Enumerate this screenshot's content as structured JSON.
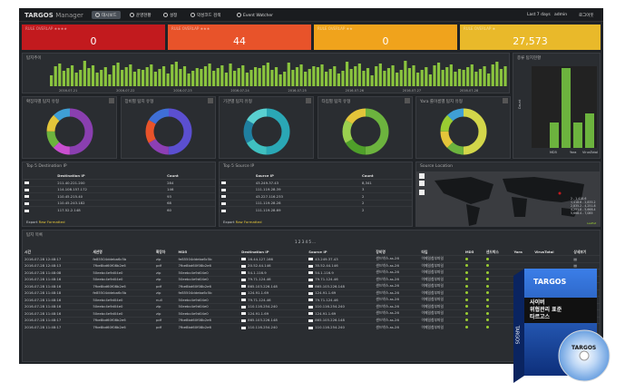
{
  "app": {
    "brand": "TARGOS",
    "brand_sub": "Manager"
  },
  "nav": [
    {
      "label": "대시보드",
      "icon": "dashboard-icon"
    },
    {
      "label": "운영현황",
      "icon": "status-icon"
    },
    {
      "label": "설정",
      "icon": "gear-icon"
    },
    {
      "label": "악성코드 검색",
      "icon": "search-icon"
    },
    {
      "label": "Event Watcher",
      "icon": "event-icon"
    }
  ],
  "top_right": {
    "range": "Last 7 days",
    "user": "admin",
    "logout": "로그아웃"
  },
  "kpis": [
    {
      "label": "RULE OVERLAP ★★★★",
      "value": "0",
      "color": "#c21a1e"
    },
    {
      "label": "RULE OVERLAP ★★★",
      "value": "44",
      "color": "#e8532a"
    },
    {
      "label": "RULE OVERLAP ★★",
      "value": "0",
      "color": "#f0a31c"
    },
    {
      "label": "RULE OVERLAP ★",
      "value": "27,573",
      "color": "#e9b92a"
    }
  ],
  "timeline": {
    "title": "탐지추이",
    "axis": [
      "2016-07-21",
      "2016-07-22",
      "2016-07-23",
      "2016-07-24",
      "2016-07-25",
      "2016-07-26",
      "2016-07-27",
      "2016-07-28"
    ]
  },
  "bar_panel": {
    "title": "종류 탐지현황",
    "ylabel": "Count",
    "xlabels": [
      "MD5",
      "Yara",
      "VirusTotal"
    ]
  },
  "donuts": [
    {
      "title": "확장자별 탐지 유형",
      "colors": [
        "#8a3fb0",
        "#c94fd0",
        "#6cb33e",
        "#e3c53a",
        "#3f9fd6"
      ]
    },
    {
      "title": "장비별 탐지 유형",
      "colors": [
        "#5b4fd0",
        "#8d3fb5",
        "#e8532a",
        "#3f6fd6"
      ]
    },
    {
      "title": "기관별 탐지 유형",
      "colors": [
        "#2aa7b5",
        "#3fc0c0",
        "#1f7fa0",
        "#59d0d0"
      ]
    },
    {
      "title": "타입별 탐지 유형",
      "colors": [
        "#6cb33e",
        "#4f9f2a",
        "#9ad04f",
        "#e3c53a"
      ]
    },
    {
      "title": "Yara 룰이름별 탐지 유형",
      "colors": [
        "#d3d64a",
        "#6cb33e",
        "#e3c53a",
        "#9acd32",
        "#3f9fd6"
      ]
    }
  ],
  "top_dest": {
    "title": "Top 5 Destination IP",
    "headers": [
      "Destination IP",
      "Count"
    ],
    "rows": [
      [
        "211.40.221.200",
        "284"
      ],
      [
        "114.108.157.172",
        "146"
      ],
      [
        "110.45.215.40",
        "93"
      ],
      [
        "110.45.243.182",
        "68"
      ],
      [
        "117.52.2.148",
        "60"
      ]
    ],
    "export": "Export",
    "raw": "Raw",
    "formatted": "Formatted"
  },
  "top_src": {
    "title": "Top 5 Source IP",
    "headers": [
      "Source IP",
      "Count"
    ],
    "rows": [
      [
        "43.249.37.43",
        "8,341"
      ],
      [
        "111.119.28.39",
        "3"
      ],
      [
        "43.227.116.233",
        "2"
      ],
      [
        "111.119.28.28",
        "2"
      ],
      [
        "111.119.28.69",
        "2"
      ]
    ],
    "export": "Export",
    "raw": "Raw",
    "formatted": "Formatted"
  },
  "map": {
    "title": "Source Location",
    "legend": [
      "2 - 1,418.6",
      "1,418.6 - 2,835.2",
      "2,835.2 - 4,251.8",
      "4,251.8 - 5,668.4",
      "5,668.4 - 7,085"
    ],
    "credit": "Leaflet"
  },
  "list": {
    "title": "탐지 목록",
    "pages": [
      "1",
      "2",
      "3",
      "4",
      "5",
      "..."
    ],
    "headers": [
      "시간",
      "세션명",
      "확장자",
      "MD5",
      "Destination IP",
      "Source IP",
      "장비명",
      "타입",
      "MD5",
      "샌드박스",
      "Yara",
      "VirusTotal",
      "상세보기"
    ],
    "rows": [
      [
        "2016-07-28 12:48:17",
        "fe85504ddeba6c5b",
        "zip",
        "fe85504ddeba6c5b",
        "16.44.127.166",
        "43.249.37.43",
        "샌드박스-ss-26",
        "이메일첨부파일"
      ],
      [
        "2016-07-28 12:48:13",
        "7fbe8bd60f08b2e6",
        "pdf",
        "7fbe8bd60f08b2e6",
        "20.52.44.146",
        "35.52.44.146",
        "샌드박스-ss-26",
        "이메일첨부파일"
      ],
      [
        "2016-07-28 11:48:08",
        "50eebc4e9d04e0",
        "zip",
        "50eebc4e9d04e0",
        "54.1.116.9",
        "54.1.116.9",
        "샌드박스-ss-26",
        "이메일첨부파일"
      ],
      [
        "2016-07-28 11:48:16",
        "50eebc4e9d04e0",
        "zip",
        "50eebc4e9d04e0",
        "79.71.124.46",
        "79.71.124.46",
        "샌드박스-ss-26",
        "이메일첨부파일"
      ],
      [
        "2016-07-28 11:48:16",
        "7fbe8bd60f08b2e6",
        "pdf",
        "7fbe8bd60f08b2e6",
        "865.103.226.148",
        "865.103.226.148",
        "샌드박스-ss-26",
        "이메일첨부파일"
      ],
      [
        "2016-07-28 11:48:18",
        "fe85504ddeba6c5b",
        "zip",
        "fe85504ddeba6c5b",
        "124.91.1.69",
        "124.91.1.69",
        "샌드박스-ss-26",
        "이메일첨부파일"
      ],
      [
        "2016-07-28 11:48:16",
        "50eebc4e9d04e0",
        "null",
        "50eebc4e9d04e0",
        "79.71.124.46",
        "79.71.124.46",
        "샌드박스-ss-26",
        "이메일첨부파일"
      ],
      [
        "2016-07-28 11:48:16",
        "50eebc4e9d04e0",
        "zip",
        "50eebc4e9d04e0",
        "110.116.254.240",
        "110.116.254.240",
        "샌드박스-ss-26",
        "이메일첨부파일"
      ],
      [
        "2016-07-28 11:48:16",
        "50eebc4e9d04e0",
        "zip",
        "50eebc4e9d04e0",
        "124.91.1.69",
        "124.91.1.69",
        "샌드박스-ss-26",
        "이메일첨부파일"
      ],
      [
        "2016-07-28 11:48:17",
        "7fbe8bd60f08b2e6",
        "pdf",
        "7fbe8bd60f08b2e6",
        "865.103.226.148",
        "865.103.226.148",
        "샌드박스-ss-26",
        "이메일첨부파일"
      ],
      [
        "2016-07-28 11:48:17",
        "7fbe8bd60f08b2e6",
        "pdf",
        "7fbe8bd60f08b2e6",
        "110.116.254.240",
        "110.116.254.240",
        "샌드박스-ss-26",
        "이메일첨부파일"
      ]
    ]
  },
  "product": {
    "brand": "TARGOS",
    "title": "사이버\n위협관리 표준\n타르고스",
    "disc": "TARGOS",
    "vertical": "TARGOS"
  }
}
